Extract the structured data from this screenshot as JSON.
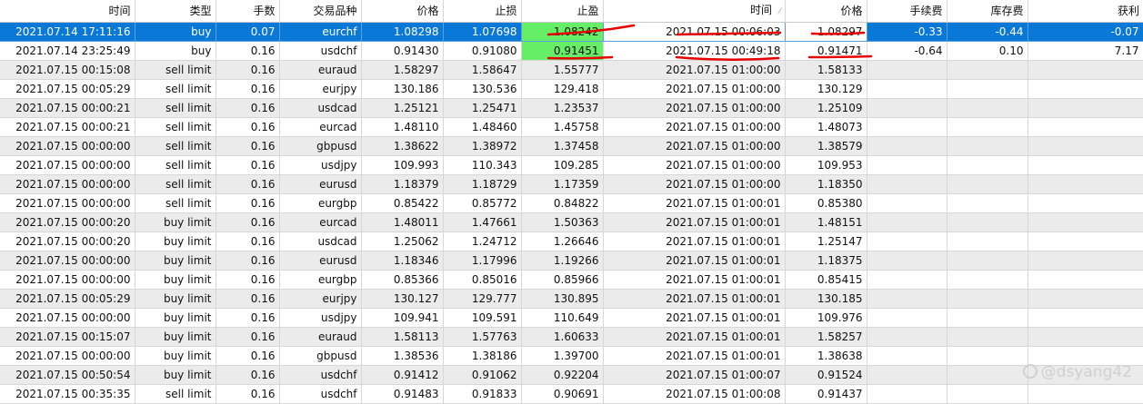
{
  "columns": [
    "时间",
    "类型",
    "手数",
    "交易品种",
    "价格",
    "止损",
    "止盈",
    "时间",
    "价格",
    "手续费",
    "库存费",
    "获利"
  ],
  "sort_indicator": "⁄",
  "rows": [
    {
      "open_time": "2021.07.14 17:11:16",
      "type": "buy",
      "lots": "0.07",
      "symbol": "eurchf",
      "price": "1.08298",
      "sl": "1.07698",
      "tp": "1.08242",
      "close_time": "2021.07.15 00:06:03",
      "close_price": "1.08297",
      "commission": "-0.33",
      "swap": "-0.44",
      "profit": "-0.07"
    },
    {
      "open_time": "2021.07.14 23:25:49",
      "type": "buy",
      "lots": "0.16",
      "symbol": "usdchf",
      "price": "0.91430",
      "sl": "0.91080",
      "tp": "0.91451",
      "close_time": "2021.07.15 00:49:18",
      "close_price": "0.91471",
      "commission": "-0.64",
      "swap": "0.10",
      "profit": "7.17"
    },
    {
      "open_time": "2021.07.15 00:15:08",
      "type": "sell limit",
      "lots": "0.16",
      "symbol": "euraud",
      "price": "1.58297",
      "sl": "1.58647",
      "tp": "1.55777",
      "close_time": "2021.07.15 01:00:00",
      "close_price": "1.58133",
      "commission": "",
      "swap": "",
      "profit": ""
    },
    {
      "open_time": "2021.07.15 00:05:29",
      "type": "sell limit",
      "lots": "0.16",
      "symbol": "eurjpy",
      "price": "130.186",
      "sl": "130.536",
      "tp": "129.418",
      "close_time": "2021.07.15 01:00:00",
      "close_price": "130.129",
      "commission": "",
      "swap": "",
      "profit": ""
    },
    {
      "open_time": "2021.07.15 00:00:21",
      "type": "sell limit",
      "lots": "0.16",
      "symbol": "usdcad",
      "price": "1.25121",
      "sl": "1.25471",
      "tp": "1.23537",
      "close_time": "2021.07.15 01:00:00",
      "close_price": "1.25109",
      "commission": "",
      "swap": "",
      "profit": ""
    },
    {
      "open_time": "2021.07.15 00:00:21",
      "type": "sell limit",
      "lots": "0.16",
      "symbol": "eurcad",
      "price": "1.48110",
      "sl": "1.48460",
      "tp": "1.45758",
      "close_time": "2021.07.15 01:00:00",
      "close_price": "1.48073",
      "commission": "",
      "swap": "",
      "profit": ""
    },
    {
      "open_time": "2021.07.15 00:00:00",
      "type": "sell limit",
      "lots": "0.16",
      "symbol": "gbpusd",
      "price": "1.38622",
      "sl": "1.38972",
      "tp": "1.37458",
      "close_time": "2021.07.15 01:00:00",
      "close_price": "1.38579",
      "commission": "",
      "swap": "",
      "profit": ""
    },
    {
      "open_time": "2021.07.15 00:00:00",
      "type": "sell limit",
      "lots": "0.16",
      "symbol": "usdjpy",
      "price": "109.993",
      "sl": "110.343",
      "tp": "109.285",
      "close_time": "2021.07.15 01:00:00",
      "close_price": "109.953",
      "commission": "",
      "swap": "",
      "profit": ""
    },
    {
      "open_time": "2021.07.15 00:00:00",
      "type": "sell limit",
      "lots": "0.16",
      "symbol": "eurusd",
      "price": "1.18379",
      "sl": "1.18729",
      "tp": "1.17359",
      "close_time": "2021.07.15 01:00:00",
      "close_price": "1.18350",
      "commission": "",
      "swap": "",
      "profit": ""
    },
    {
      "open_time": "2021.07.15 00:00:00",
      "type": "sell limit",
      "lots": "0.16",
      "symbol": "eurgbp",
      "price": "0.85422",
      "sl": "0.85772",
      "tp": "0.84822",
      "close_time": "2021.07.15 01:00:01",
      "close_price": "0.85380",
      "commission": "",
      "swap": "",
      "profit": ""
    },
    {
      "open_time": "2021.07.15 00:00:20",
      "type": "buy limit",
      "lots": "0.16",
      "symbol": "eurcad",
      "price": "1.48011",
      "sl": "1.47661",
      "tp": "1.50363",
      "close_time": "2021.07.15 01:00:01",
      "close_price": "1.48151",
      "commission": "",
      "swap": "",
      "profit": ""
    },
    {
      "open_time": "2021.07.15 00:00:20",
      "type": "buy limit",
      "lots": "0.16",
      "symbol": "usdcad",
      "price": "1.25062",
      "sl": "1.24712",
      "tp": "1.26646",
      "close_time": "2021.07.15 01:00:01",
      "close_price": "1.25147",
      "commission": "",
      "swap": "",
      "profit": ""
    },
    {
      "open_time": "2021.07.15 00:00:00",
      "type": "buy limit",
      "lots": "0.16",
      "symbol": "eurusd",
      "price": "1.18346",
      "sl": "1.17996",
      "tp": "1.19266",
      "close_time": "2021.07.15 01:00:01",
      "close_price": "1.18375",
      "commission": "",
      "swap": "",
      "profit": ""
    },
    {
      "open_time": "2021.07.15 00:00:00",
      "type": "buy limit",
      "lots": "0.16",
      "symbol": "eurgbp",
      "price": "0.85366",
      "sl": "0.85016",
      "tp": "0.85966",
      "close_time": "2021.07.15 01:00:01",
      "close_price": "0.85415",
      "commission": "",
      "swap": "",
      "profit": ""
    },
    {
      "open_time": "2021.07.15 00:05:29",
      "type": "buy limit",
      "lots": "0.16",
      "symbol": "eurjpy",
      "price": "130.127",
      "sl": "129.777",
      "tp": "130.895",
      "close_time": "2021.07.15 01:00:01",
      "close_price": "130.185",
      "commission": "",
      "swap": "",
      "profit": ""
    },
    {
      "open_time": "2021.07.15 00:00:00",
      "type": "buy limit",
      "lots": "0.16",
      "symbol": "usdjpy",
      "price": "109.941",
      "sl": "109.591",
      "tp": "110.649",
      "close_time": "2021.07.15 01:00:01",
      "close_price": "109.976",
      "commission": "",
      "swap": "",
      "profit": ""
    },
    {
      "open_time": "2021.07.15 00:15:07",
      "type": "buy limit",
      "lots": "0.16",
      "symbol": "euraud",
      "price": "1.58113",
      "sl": "1.57763",
      "tp": "1.60633",
      "close_time": "2021.07.15 01:00:01",
      "close_price": "1.58257",
      "commission": "",
      "swap": "",
      "profit": ""
    },
    {
      "open_time": "2021.07.15 00:00:00",
      "type": "buy limit",
      "lots": "0.16",
      "symbol": "gbpusd",
      "price": "1.38536",
      "sl": "1.38186",
      "tp": "1.39700",
      "close_time": "2021.07.15 01:00:01",
      "close_price": "1.38638",
      "commission": "",
      "swap": "",
      "profit": ""
    },
    {
      "open_time": "2021.07.15 00:50:54",
      "type": "buy limit",
      "lots": "0.16",
      "symbol": "usdchf",
      "price": "0.91412",
      "sl": "0.91062",
      "tp": "0.92204",
      "close_time": "2021.07.15 01:00:07",
      "close_price": "0.91524",
      "commission": "",
      "swap": "",
      "profit": ""
    },
    {
      "open_time": "2021.07.15 00:35:35",
      "type": "sell limit",
      "lots": "0.16",
      "symbol": "usdchf",
      "price": "0.91483",
      "sl": "0.91833",
      "tp": "0.90691",
      "close_time": "2021.07.15 01:00:08",
      "close_price": "0.91437",
      "commission": "",
      "swap": "",
      "profit": ""
    }
  ],
  "colors": {
    "selected_row": "#0a78d7",
    "tp_highlight": "#66ee66",
    "annotation": "#e60000",
    "alt_row": "#ebebeb"
  },
  "watermark": {
    "text": "@dsyang42",
    "icon": "weibo-logo-icon"
  }
}
